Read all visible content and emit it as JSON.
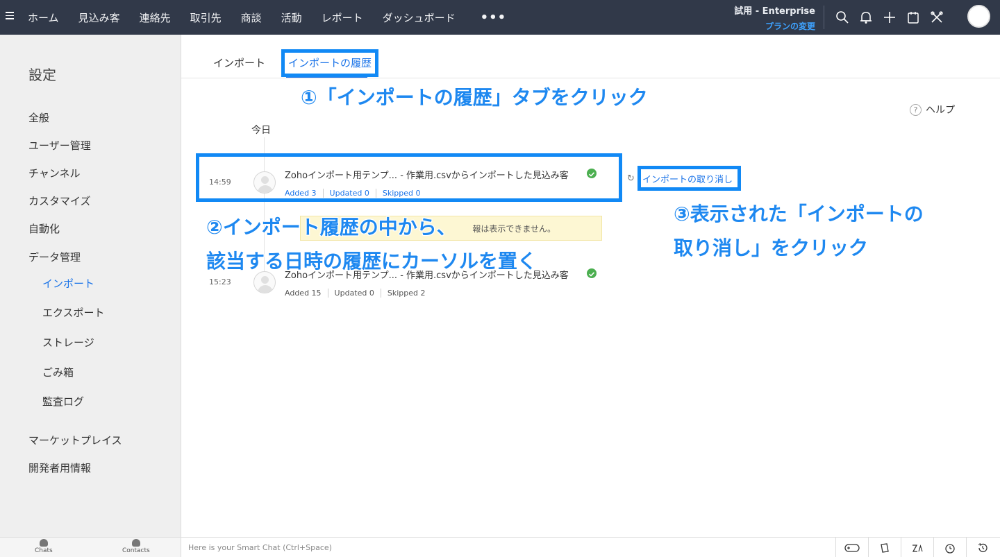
{
  "topbar": {
    "nav": [
      "ホーム",
      "見込み客",
      "連絡先",
      "取引先",
      "商談",
      "活動",
      "レポート",
      "ダッシュボード"
    ],
    "more": "•••",
    "trial_label": "試用 - Enterprise",
    "plan_change": "プランの変更",
    "icons": [
      "search-icon",
      "bell-icon",
      "plus-icon",
      "calendar-icon",
      "tools-icon"
    ]
  },
  "sidebar": {
    "title": "設定",
    "items": {
      "general": "全般",
      "users": "ユーザー管理",
      "channels": "チャンネル",
      "customize": "カスタマイズ",
      "automation": "自動化",
      "data_management": "データ管理",
      "import": "インポート",
      "export": "エクスポート",
      "storage": "ストレージ",
      "recycle_bin": "ごみ箱",
      "audit_log": "監査ログ",
      "marketplace": "マーケットプレイス",
      "developer": "開発者用情報"
    }
  },
  "tabs": {
    "import": "インポート",
    "history": "インポートの履歴"
  },
  "help": "ヘルプ",
  "today": "今日",
  "history": [
    {
      "time": "14:59",
      "title": "Zohoインポート用テンプ... - 作業用.csvからインポートした見込み客",
      "added": "Added 3",
      "updated": "Updated 0",
      "skipped": "Skipped 0"
    },
    {
      "time": "15:23",
      "title": "Zohoインポート用テンプ... - 作業用.csvからインポートした見込み客",
      "added": "Added 15",
      "updated": "Updated 0",
      "skipped": "Skipped 2"
    }
  ],
  "undo_label": "インポートの取り消し",
  "notice": "報は表示できません。",
  "annotations": {
    "step1": "①「インポートの履歴」タブをクリック",
    "step2_line1": "②インポート履歴の中から、",
    "step2_line2": "該当する日時の履歴にカーソルを置く",
    "step3_line1": "③表示された「インポートの",
    "step3_line2": "取り消し」をクリック"
  },
  "bottombar": {
    "chats": "Chats",
    "contacts": "Contacts",
    "smart_chat": "Here is your Smart Chat (Ctrl+Space)"
  },
  "colors": {
    "topbar_bg": "#313949",
    "accent": "#1a73e8",
    "annotation_blue": "#1189f5",
    "success": "#4caf50"
  }
}
